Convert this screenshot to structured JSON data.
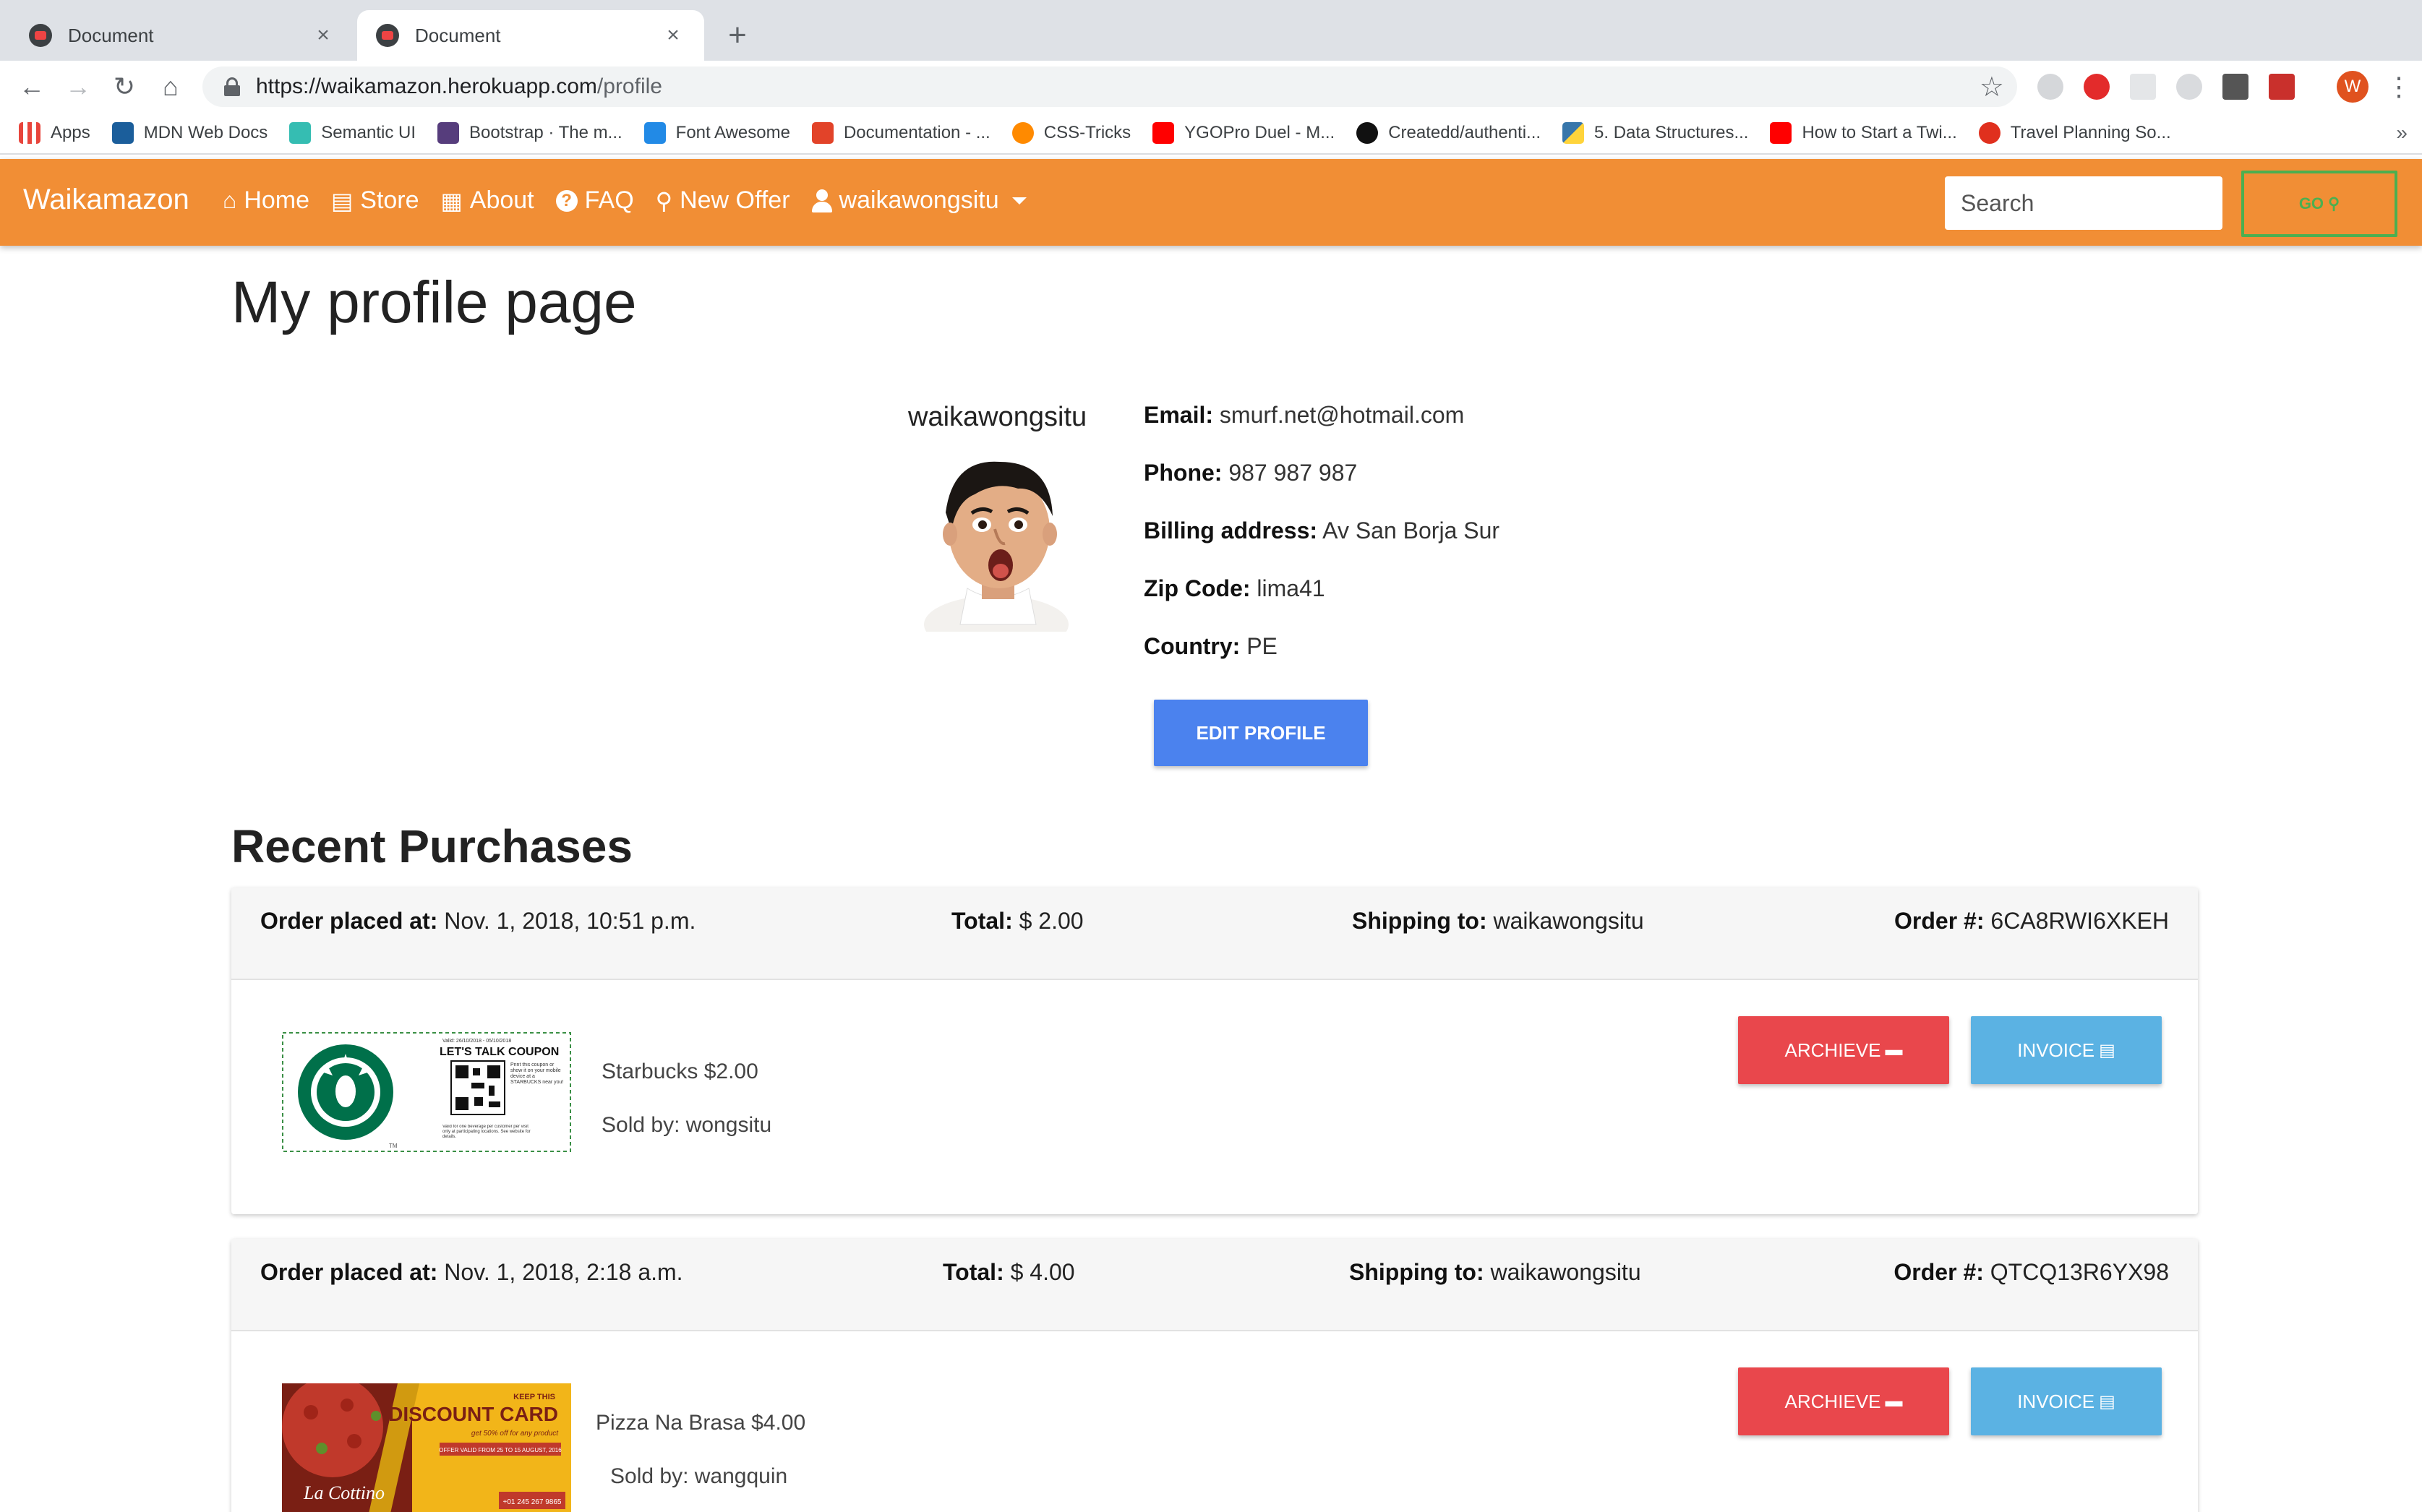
{
  "browser": {
    "tabs": [
      {
        "title": "Document",
        "close": "×"
      },
      {
        "title": "Document",
        "close": "×"
      }
    ],
    "new_tab": "+",
    "url_host": "https://waikamazon.herokuapp.com",
    "url_path": "/profile",
    "profile_initial": "W",
    "bookmarks": [
      {
        "label": "Apps",
        "icon": "apps-grid-icon",
        "color": "#e8453c"
      },
      {
        "label": "MDN Web Docs",
        "icon": "mdn-icon",
        "color": "#1b5e9b"
      },
      {
        "label": "Semantic UI",
        "icon": "semantic-ui-icon",
        "color": "#35bdb2"
      },
      {
        "label": "Bootstrap · The m...",
        "icon": "bootstrap-icon",
        "color": "#563d7c"
      },
      {
        "label": "Font Awesome",
        "icon": "font-awesome-flag-icon",
        "color": "#228ae6"
      },
      {
        "label": "Documentation - ...",
        "icon": "documentation-icon",
        "color": "#e24329"
      },
      {
        "label": "CSS-Tricks",
        "icon": "css-tricks-icon",
        "color": "#ff8a00"
      },
      {
        "label": "YGOPro Duel - M...",
        "icon": "youtube-icon",
        "color": "#ff0000"
      },
      {
        "label": "Createdd/authenti...",
        "icon": "github-icon",
        "color": "#111111"
      },
      {
        "label": "5. Data Structures...",
        "icon": "python-icon",
        "color": "#3776ab"
      },
      {
        "label": "How to Start a Twi...",
        "icon": "youtube-icon",
        "color": "#ff0000"
      },
      {
        "label": "Travel Planning So...",
        "icon": "crescent-icon",
        "color": "#e0301e"
      }
    ],
    "bookmarks_more": "»"
  },
  "nav": {
    "brand": "Waikamazon",
    "links": [
      {
        "label": "Home",
        "icon": "home-icon",
        "glyph": "⌂"
      },
      {
        "label": "Store",
        "icon": "store-icon",
        "glyph": "▤"
      },
      {
        "label": "About",
        "icon": "building-icon",
        "glyph": "▦"
      },
      {
        "label": "FAQ",
        "icon": "question-circle-icon",
        "glyph": "?"
      },
      {
        "label": "New Offer",
        "icon": "hand-holding-icon",
        "glyph": "⚲"
      }
    ],
    "user": "waikawongsitu",
    "search_placeholder": "Search",
    "go_label": "GO",
    "colors": {
      "bar": "#f18e35",
      "go": "#4caf50"
    }
  },
  "profile": {
    "page_title": "My profile page",
    "username": "waikawongsitu",
    "email_label": "Email:",
    "email": "smurf.net@hotmail.com",
    "phone_label": "Phone:",
    "phone": "987 987 987",
    "billing_label": "Billing address:",
    "billing": "Av San Borja Sur",
    "zip_label": "Zip Code:",
    "zip": "lima41",
    "country_label": "Country:",
    "country": "PE",
    "edit_button": "EDIT PROFILE"
  },
  "purchases": {
    "title": "Recent Purchases",
    "placed_label": "Order placed at:",
    "total_label": "Total:",
    "shipping_label": "Shipping to:",
    "order_label": "Order #:",
    "archieve_label": "ARCHIEVE",
    "invoice_label": "INVOICE",
    "orders": [
      {
        "placed_at": "Nov. 1, 2018, 10:51 p.m.",
        "total": "$ 2.00",
        "shipping_to": "waikawongsitu",
        "order_number": "6CA8RWI6XKEH",
        "item": "Starbucks $2.00",
        "sold_by": "Sold by: wongsitu",
        "coupon_text": {
          "valid": "Valid: 26/10/2018 - 05/10/2018",
          "headline": "LET'S TALK COUPON",
          "side": "Print this coupon or show it on your mobile device at a STARBUCKS near you!",
          "fine": "Valid for one beverage per customer per visit only at participating locations. See website for details.",
          "tm": "TM"
        }
      },
      {
        "placed_at": "Nov. 1, 2018, 2:18 a.m.",
        "total": "$ 4.00",
        "shipping_to": "waikawongsitu",
        "order_number": "QTCQ13R6YX98",
        "item": "Pizza Na Brasa $4.00",
        "sold_by": "Sold by: wangquin",
        "coupon_text": {
          "keep": "KEEP THIS",
          "headline": "DISCOUNT CARD",
          "sub": "get 50% off for any product",
          "offer": "OFFER VALID FROM 25 TO 15 AUGUST, 2016",
          "brand": "La Cottino",
          "phone": "+01 245 267 9865"
        }
      }
    ]
  }
}
